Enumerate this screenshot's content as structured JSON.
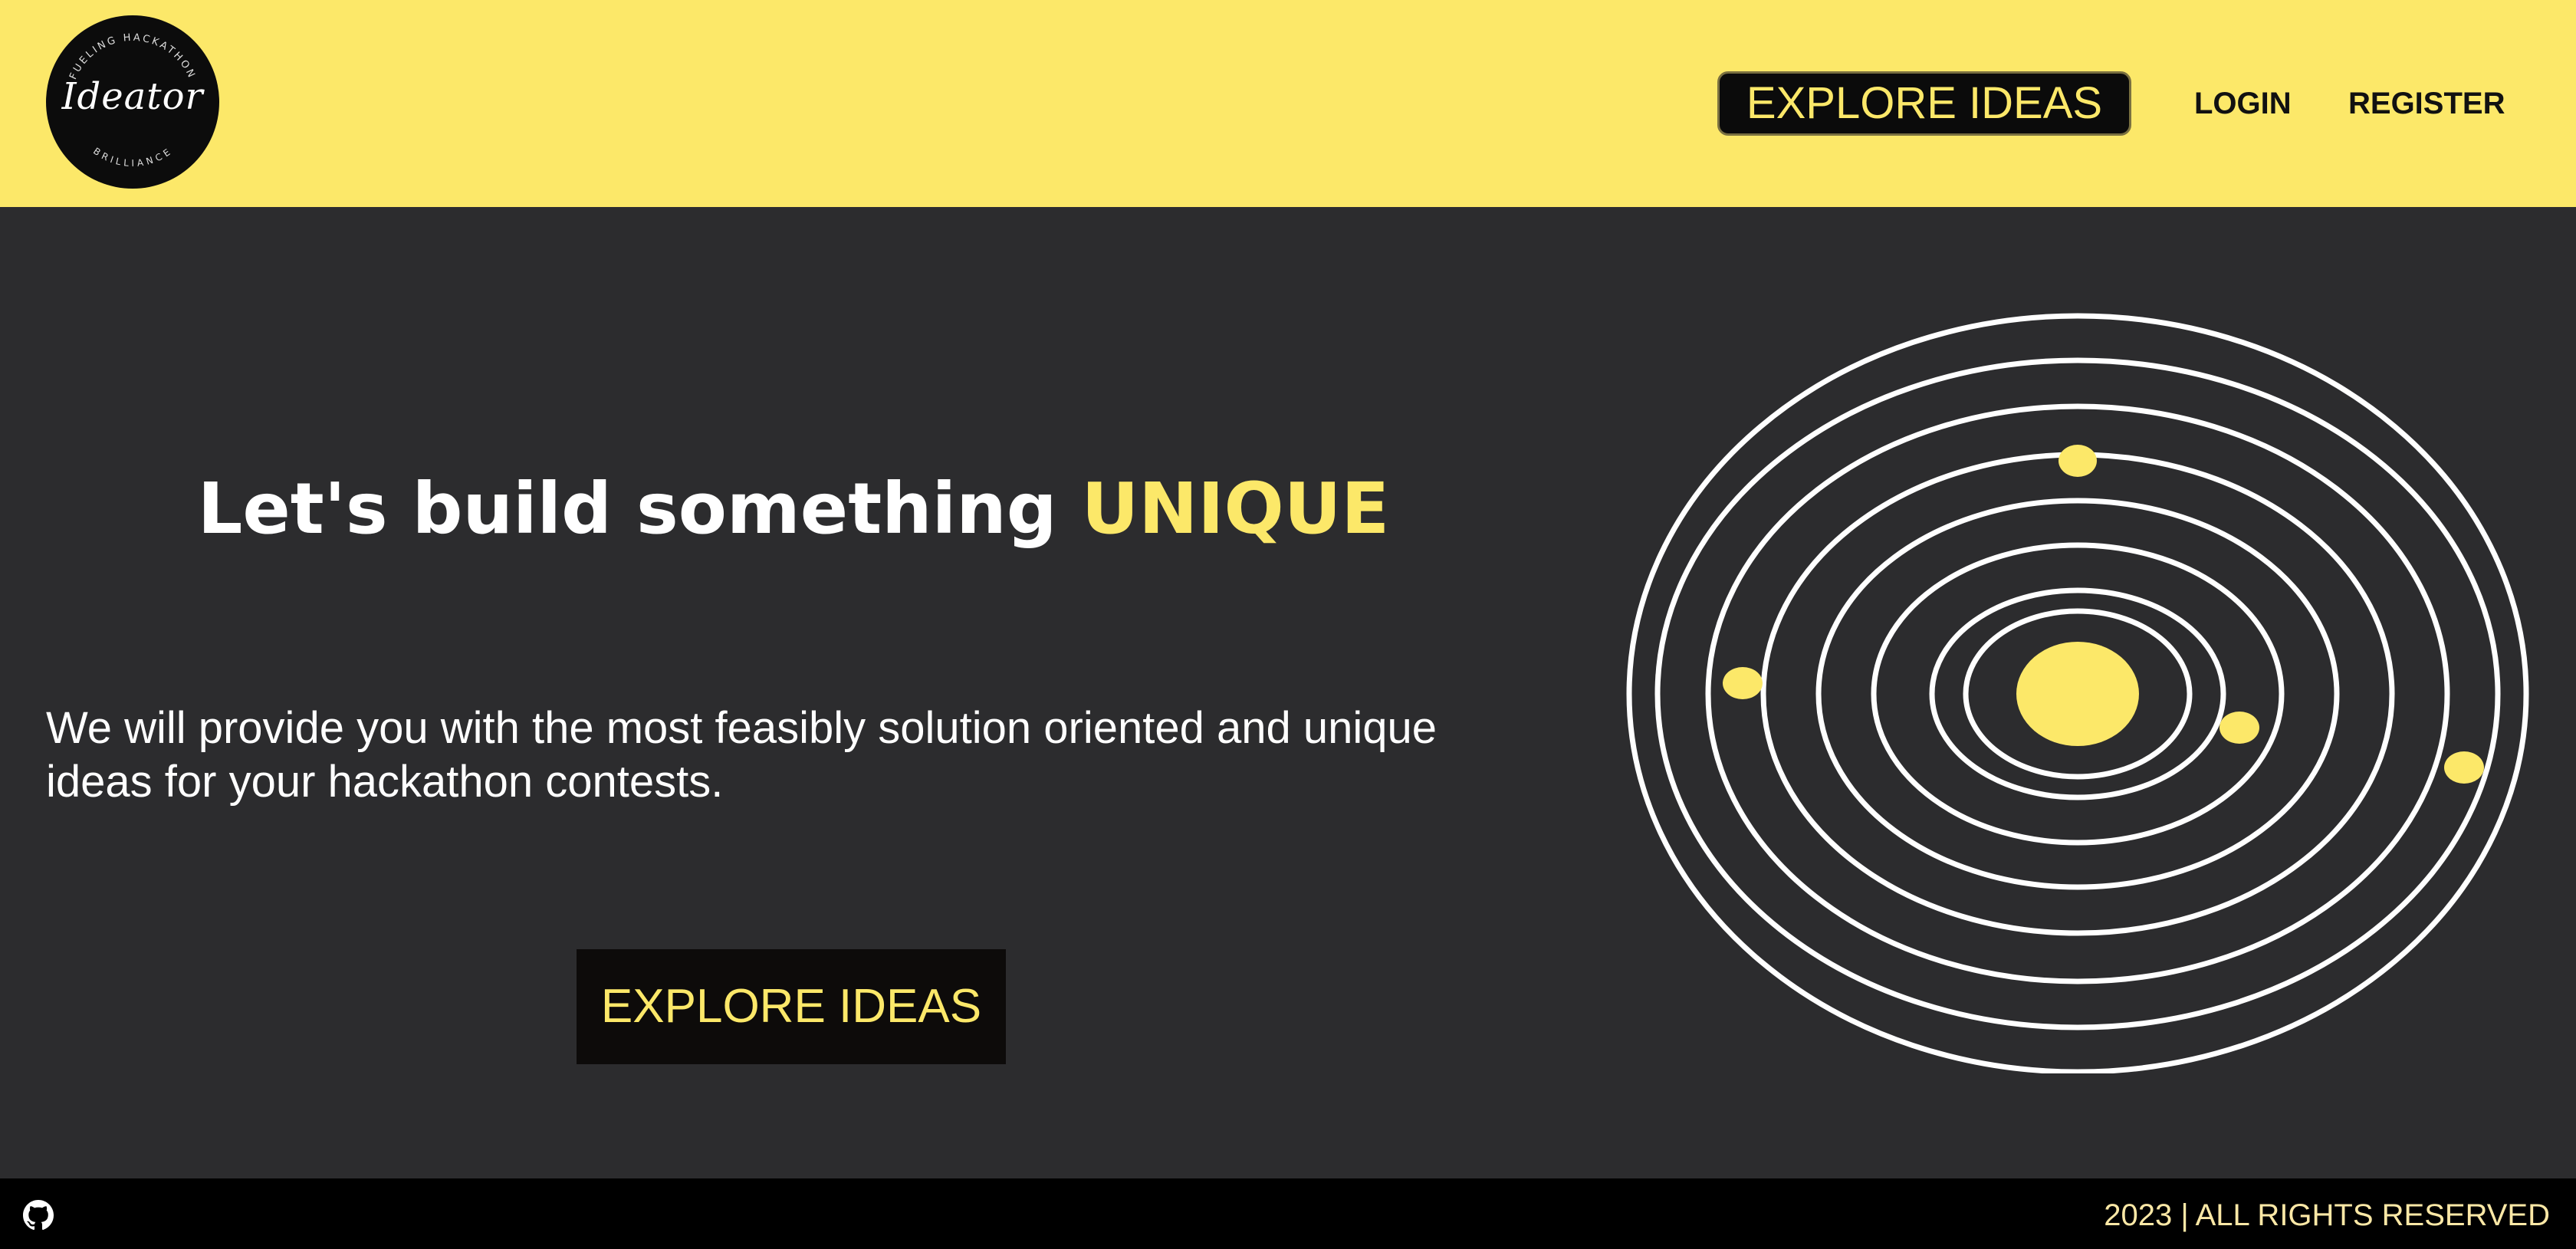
{
  "header": {
    "logo": {
      "script_text": "Ideator",
      "ring_top": "FUELING HACKATHON",
      "ring_bottom": "BRILLIANCE"
    },
    "nav": {
      "explore_label": "EXPLORE IDEAS",
      "login_label": "LOGIN",
      "register_label": "REGISTER"
    }
  },
  "hero": {
    "title_prefix": "Let's build something ",
    "title_accent": "UNIQUE",
    "description": "We will provide you with the most feasibly solution oriented and unique ideas for your hackathon contests.",
    "cta_label": "EXPLORE IDEAS",
    "illustration": {
      "icon": "solar-system-orbits",
      "ring_color": "#ffffff",
      "planet_color": "#fce869"
    }
  },
  "footer": {
    "github_icon": "github-icon",
    "copyright": "2023 | ALL RIGHTS RESERVED"
  },
  "colors": {
    "brand_yellow": "#fce869",
    "background": "#2c2c2e",
    "footer_bg": "#000000"
  }
}
